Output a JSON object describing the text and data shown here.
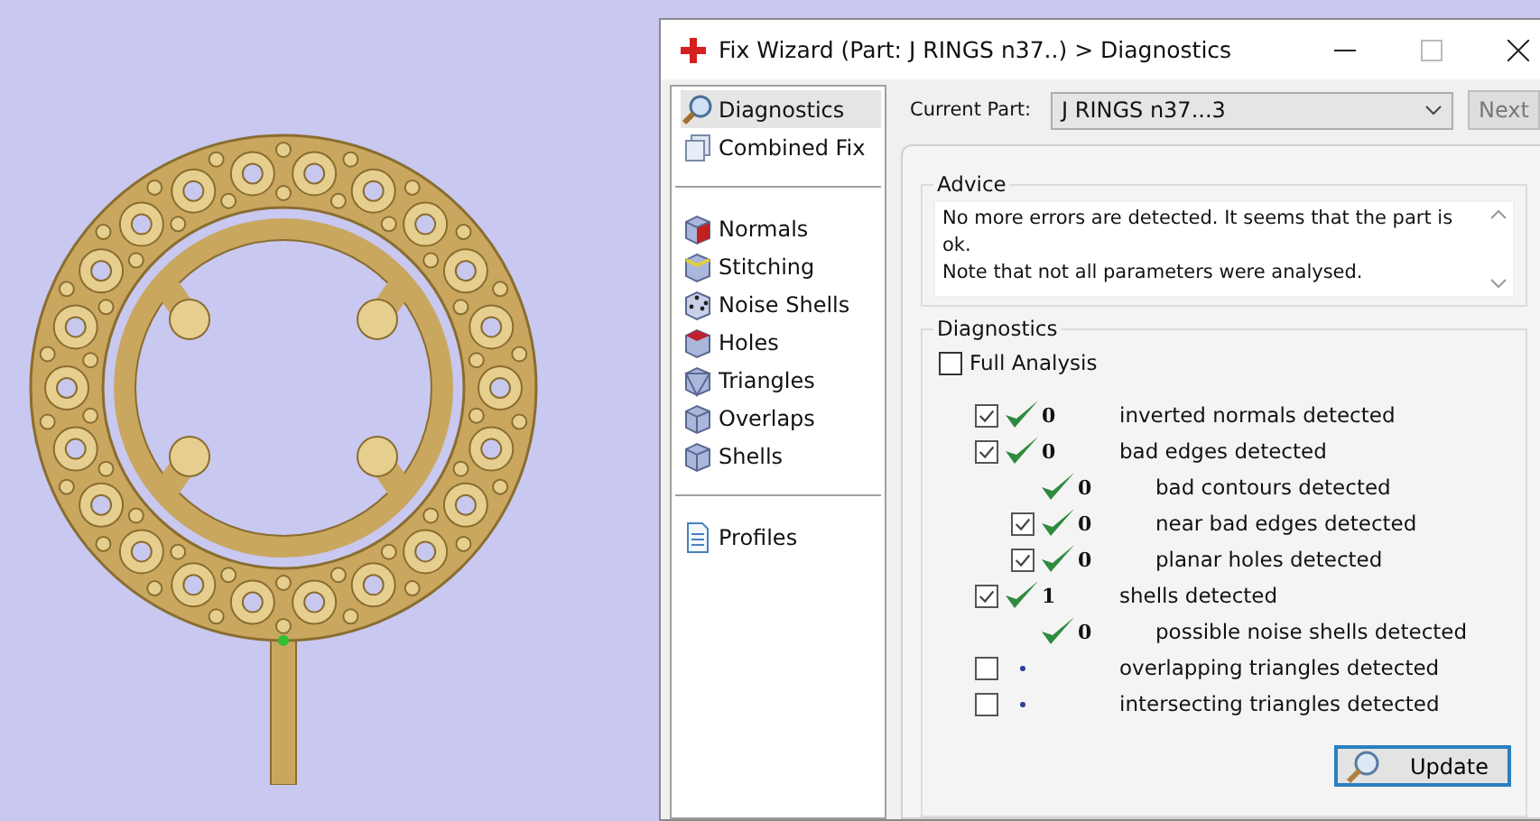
{
  "window": {
    "title": "Fix Wizard (Part: J RINGS n37..) > Diagnostics"
  },
  "sidebar": {
    "groups": [
      [
        {
          "label": "Diagnostics",
          "selected": true
        },
        {
          "label": "Combined Fix",
          "selected": false
        }
      ],
      [
        {
          "label": "Normals",
          "selected": false
        },
        {
          "label": "Stitching",
          "selected": false
        },
        {
          "label": "Noise Shells",
          "selected": false
        },
        {
          "label": "Holes",
          "selected": false
        },
        {
          "label": "Triangles",
          "selected": false
        },
        {
          "label": "Overlaps",
          "selected": false
        },
        {
          "label": "Shells",
          "selected": false
        }
      ],
      [
        {
          "label": "Profiles",
          "selected": false
        }
      ]
    ]
  },
  "current_part": {
    "label": "Current Part:",
    "value": "J RINGS n37...3"
  },
  "next_button": {
    "label": "Next",
    "disabled": true
  },
  "advice": {
    "title": "Advice",
    "text": "No more errors are detected. It seems that the part is ok.\nNote that not all parameters were analysed."
  },
  "diagnostics": {
    "title": "Diagnostics",
    "full_analysis": {
      "label": "Full Analysis",
      "checked": false
    },
    "rows": [
      {
        "checked": true,
        "kind": "ok",
        "count": "0",
        "label": "inverted normals detected"
      },
      {
        "checked": true,
        "kind": "ok",
        "count": "0",
        "label": "bad edges detected",
        "children": [
          {
            "kind": "ok",
            "count": "0",
            "label": "bad contours detected"
          },
          {
            "checked": true,
            "kind": "ok",
            "count": "0",
            "label": "near bad edges detected"
          },
          {
            "checked": true,
            "kind": "ok",
            "count": "0",
            "label": "planar holes detected"
          }
        ]
      },
      {
        "checked": true,
        "kind": "ok",
        "count": "1",
        "label": "shells detected",
        "children": [
          {
            "kind": "ok",
            "count": "0",
            "label": "possible noise shells detected"
          }
        ]
      },
      {
        "checked": false,
        "kind": "pending",
        "label": "overlapping triangles detected"
      },
      {
        "checked": false,
        "kind": "pending",
        "label": "intersecting triangles detected"
      }
    ]
  },
  "update_button": {
    "label": "Update"
  }
}
